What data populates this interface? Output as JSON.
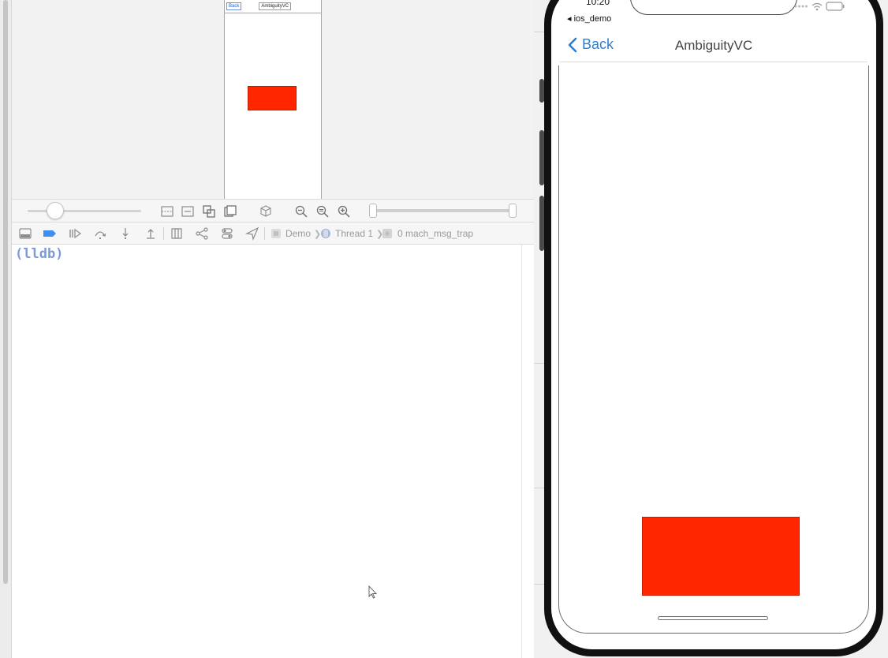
{
  "xcode": {
    "view_debugger": {
      "mini_back_label": "Back",
      "mini_title": "AmbiguityVC"
    },
    "debug_bar": {
      "breadcrumbs": [
        {
          "label": "Demo"
        },
        {
          "label": "Thread 1"
        },
        {
          "label": "0 mach_msg_trap"
        }
      ]
    },
    "console": {
      "prompt": "(lldb)"
    }
  },
  "simulator": {
    "status_time": "10:20",
    "status_back_app": "◂ ios_demo",
    "nav_back_label": "Back",
    "nav_title": "AmbiguityVC",
    "colors": {
      "accent": "#2f7fd1",
      "red_view": "#ff2600"
    }
  }
}
